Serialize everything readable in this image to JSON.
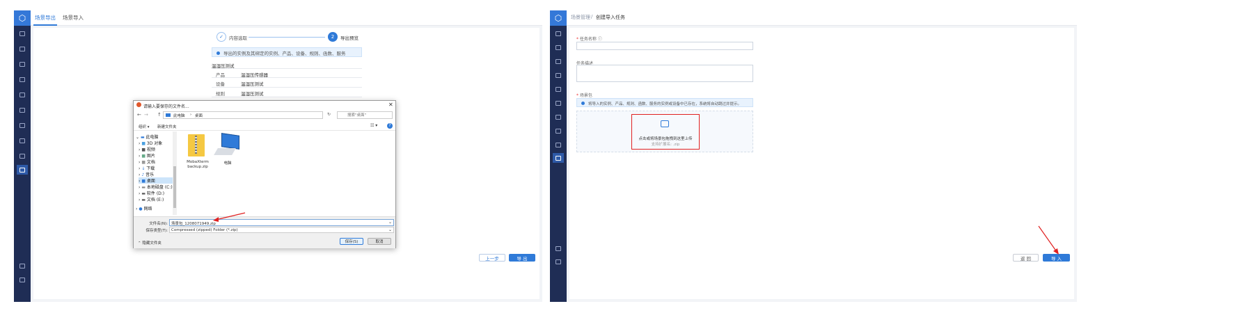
{
  "left": {
    "tabs": [
      {
        "label": "场景导出"
      },
      {
        "label": "场景导入"
      }
    ],
    "steps": [
      {
        "label": "内容选取",
        "mark": "✓"
      },
      {
        "label": "导出预览",
        "mark": "2"
      }
    ],
    "info": "导出的实例及其绑定的实例、产品、设备、规则、函数、服务",
    "scene_name": "温湿压测试",
    "rows": [
      {
        "k": "产品",
        "v": "温湿压传感器"
      },
      {
        "k": "设备",
        "v": "温湿压测试"
      },
      {
        "k": "规则",
        "v": "温湿压测试"
      }
    ],
    "buttons": {
      "prev": "上一步",
      "export": "导 出"
    }
  },
  "dialog": {
    "title": "请输入要保存的文件名...",
    "close": "✕",
    "nav": {
      "back": "←",
      "forward": "→",
      "up": "↑",
      "path": [
        "此电脑",
        "桌面"
      ],
      "refresh": "↻",
      "search_placeholder": "搜索\"桌面\""
    },
    "toolbar": {
      "organize": "组织 ▾",
      "new_folder": "新建文件夹",
      "view": "☷ ▾",
      "help": "?"
    },
    "tree": [
      {
        "label": "此电脑",
        "indent": 0,
        "arrow": "⌄"
      },
      {
        "label": "3D 对象",
        "indent": 1,
        "arrow": "›"
      },
      {
        "label": "视频",
        "indent": 1,
        "arrow": "›"
      },
      {
        "label": "图片",
        "indent": 1,
        "arrow": "›"
      },
      {
        "label": "文档",
        "indent": 1,
        "arrow": "›"
      },
      {
        "label": "下载",
        "indent": 1,
        "arrow": "›"
      },
      {
        "label": "音乐",
        "indent": 1,
        "arrow": "›"
      },
      {
        "label": "桌面",
        "indent": 1,
        "arrow": "›"
      },
      {
        "label": "本地磁盘 (C:)",
        "indent": 1,
        "arrow": "›"
      },
      {
        "label": "软件 (D:)",
        "indent": 1,
        "arrow": "›"
      },
      {
        "label": "文档 (E:)",
        "indent": 1,
        "arrow": "›"
      },
      {
        "label": "网络",
        "indent": 0,
        "arrow": "›"
      }
    ],
    "files": [
      {
        "name1": "MobaXterm",
        "name2": "backup.zip"
      },
      {
        "name1": "电脑",
        "name2": ""
      }
    ],
    "filename_label": "文件名(N):",
    "filename_value": "场景包_1208071949.zip",
    "filetype_label": "保存类型(T):",
    "filetype_value": "Compressed (zipped) Folder (*.zip)",
    "hide_folders": "隐藏文件夹",
    "save": "保存(S)",
    "cancel": "取消"
  },
  "right": {
    "breadcrumb": {
      "parent": "场景管理",
      "sep": "/",
      "current": "创建导入任务"
    },
    "task_name_label": "任务名称",
    "desc_label": "任务描述",
    "pkg_label": "场景包",
    "pkg_info": "将导入的实例、产品、规则、函数、服务的实例或设备中已存在，系统将自动跳过并提示。",
    "upload_text": "点击或将场景包拖拽到这里上传",
    "upload_hint": "支持扩展名: .zip",
    "buttons": {
      "back": "返 回",
      "import": "导 入"
    }
  },
  "colors": {
    "accent": "#2f7ad8",
    "sidebar": "#1f2d55",
    "annotation": "#e02020"
  }
}
